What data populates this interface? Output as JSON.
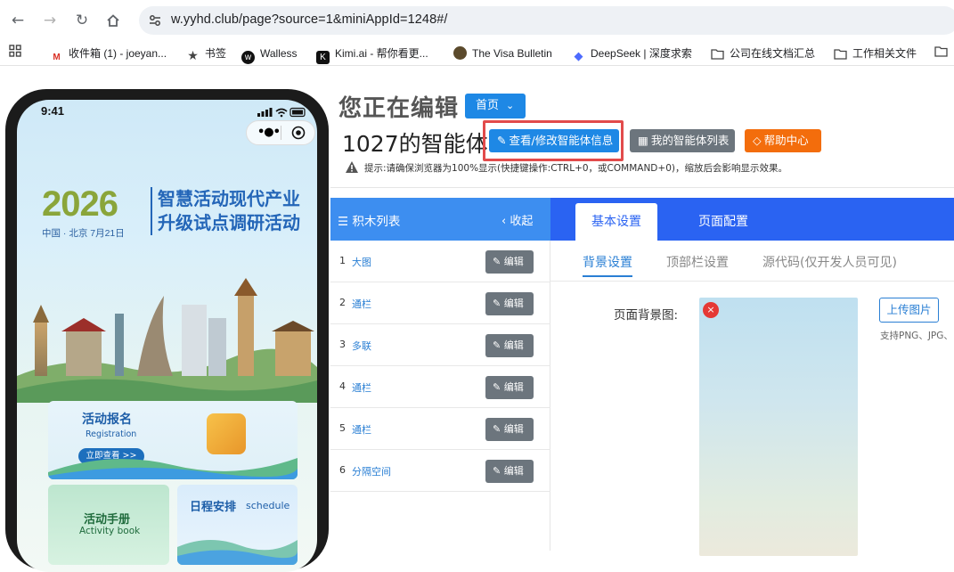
{
  "browser": {
    "url": "w.yyhd.club/page?source=1&miniAppId=1248#/",
    "bookmarks": [
      {
        "label": "收件箱 (1) - joeyan...",
        "icon": "gmail-icon"
      },
      {
        "label": "书签",
        "icon": "star-icon"
      },
      {
        "label": "Walless",
        "icon": "walless-icon"
      },
      {
        "label": "Kimi.ai - 帮你看更...",
        "icon": "kimi-icon"
      },
      {
        "label": "The Visa Bulletin",
        "icon": "seal-icon"
      },
      {
        "label": "DeepSeek | 深度求索",
        "icon": "deepseek-icon"
      },
      {
        "label": "公司在线文档汇总",
        "icon": "folder-icon"
      },
      {
        "label": "工作相关文件",
        "icon": "folder-icon"
      }
    ]
  },
  "phone": {
    "time": "9:41",
    "hero_year": "2026",
    "hero_sub": "中国 · 北京 7月21日",
    "hero_title": "智慧活动现代产业升级试点调研活动",
    "cards": {
      "registration": {
        "title": "活动报名",
        "subtitle": "Registration",
        "cta": "立即查看 >>"
      },
      "handbook": {
        "title": "活动手册",
        "subtitle": "Activity book"
      },
      "schedule": {
        "title": "日程安排",
        "subtitle": "schedule"
      }
    }
  },
  "editor": {
    "editing_title": "您正在编辑",
    "home_dropdown": "首页",
    "agent_name": "1027的智能体",
    "btn_view_edit": "查看/修改智能体信息",
    "btn_agent_list": "我的智能体列表",
    "btn_help": "帮助中心",
    "tip": "提示:请确保浏览器为100%显示(快捷键操作:CTRL+0，或COMMAND+0)，缩放后会影响显示效果。"
  },
  "blocks": {
    "title": "积木列表",
    "collapse": "收起",
    "edit_label": "编辑",
    "items": [
      {
        "idx": "1",
        "name": "大图"
      },
      {
        "idx": "2",
        "name": "通栏"
      },
      {
        "idx": "3",
        "name": "多联"
      },
      {
        "idx": "4",
        "name": "通栏"
      },
      {
        "idx": "5",
        "name": "通栏"
      },
      {
        "idx": "6",
        "name": "分隔空间"
      }
    ]
  },
  "config": {
    "tab_basic": "基本设置",
    "tab_page": "页面配置",
    "subtab_bg": "背景设置",
    "subtab_top": "顶部栏设置",
    "subtab_src": "源代码(仅开发人员可见)",
    "bg_label": "页面背景图:",
    "upload": "上传图片",
    "upload_hint": "支持PNG、JPG、"
  },
  "colors": {
    "primary": "#1e88e5",
    "grey_btn": "#6c757d",
    "orange": "#f36d0c",
    "highlight": "#e24b4b",
    "tab_bar": "#2a63f2"
  }
}
